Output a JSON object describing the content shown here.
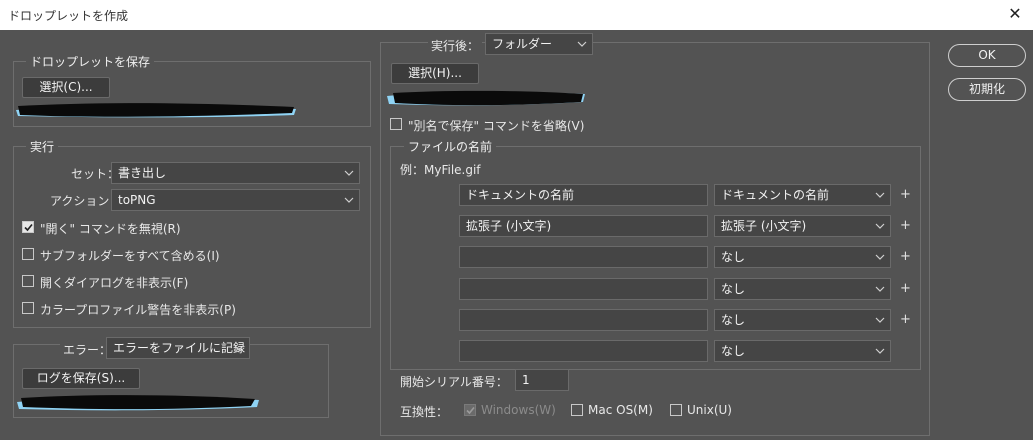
{
  "window": {
    "title": "ドロップレットを作成",
    "close_icon": "close-icon"
  },
  "save_droplet": {
    "legend": "ドロップレットを保存",
    "choose_button": "選択(C)..."
  },
  "play": {
    "legend": "実行",
    "set_label": "セット：",
    "set_value": "書き出し",
    "action_label": "アクション：",
    "action_value": "toPNG",
    "options": [
      {
        "label": "\"開く\" コマンドを無視(R)",
        "checked": true
      },
      {
        "label": "サブフォルダーをすべて含める(I)",
        "checked": false
      },
      {
        "label": "開くダイアログを非表示(F)",
        "checked": false
      },
      {
        "label": "カラープロファイル警告を非表示(P)",
        "checked": false
      }
    ]
  },
  "errors": {
    "label": "エラー：",
    "value": "エラーをファイルに記録",
    "save_log_button": "ログを保存(S)..."
  },
  "destination": {
    "label": "実行後：",
    "value": "フォルダー",
    "choose_button": "選択(H)...",
    "override_save_as": {
      "label": "\"別名で保存\" コマンドを省略(V)",
      "checked": false
    }
  },
  "file_naming": {
    "legend": "ファイルの名前",
    "example": "例：MyFile.gif",
    "rows": [
      {
        "text": "ドキュメントの名前",
        "select": "ドキュメントの名前",
        "plus": "+"
      },
      {
        "text": "拡張子 (小文字)",
        "select": "拡張子 (小文字)",
        "plus": "+"
      },
      {
        "text": "",
        "select": "なし",
        "plus": "+"
      },
      {
        "text": "",
        "select": "なし",
        "plus": "+"
      },
      {
        "text": "",
        "select": "なし",
        "plus": "+"
      },
      {
        "text": "",
        "select": "なし",
        "plus": ""
      }
    ],
    "serial_label": "開始シリアル番号：",
    "serial_value": "1",
    "compat_label": "互換性：",
    "compat": [
      {
        "label": "Windows(W)",
        "checked": true,
        "disabled": true
      },
      {
        "label": "Mac OS(M)",
        "checked": false,
        "disabled": false
      },
      {
        "label": "Unix(U)",
        "checked": false,
        "disabled": false
      }
    ]
  },
  "buttons": {
    "ok": "OK",
    "reset": "初期化"
  },
  "colors": {
    "panel": "#535353",
    "field": "#454545",
    "scribble_black": "#0a0a0a",
    "scribble_blue": "#8fd3f4"
  }
}
